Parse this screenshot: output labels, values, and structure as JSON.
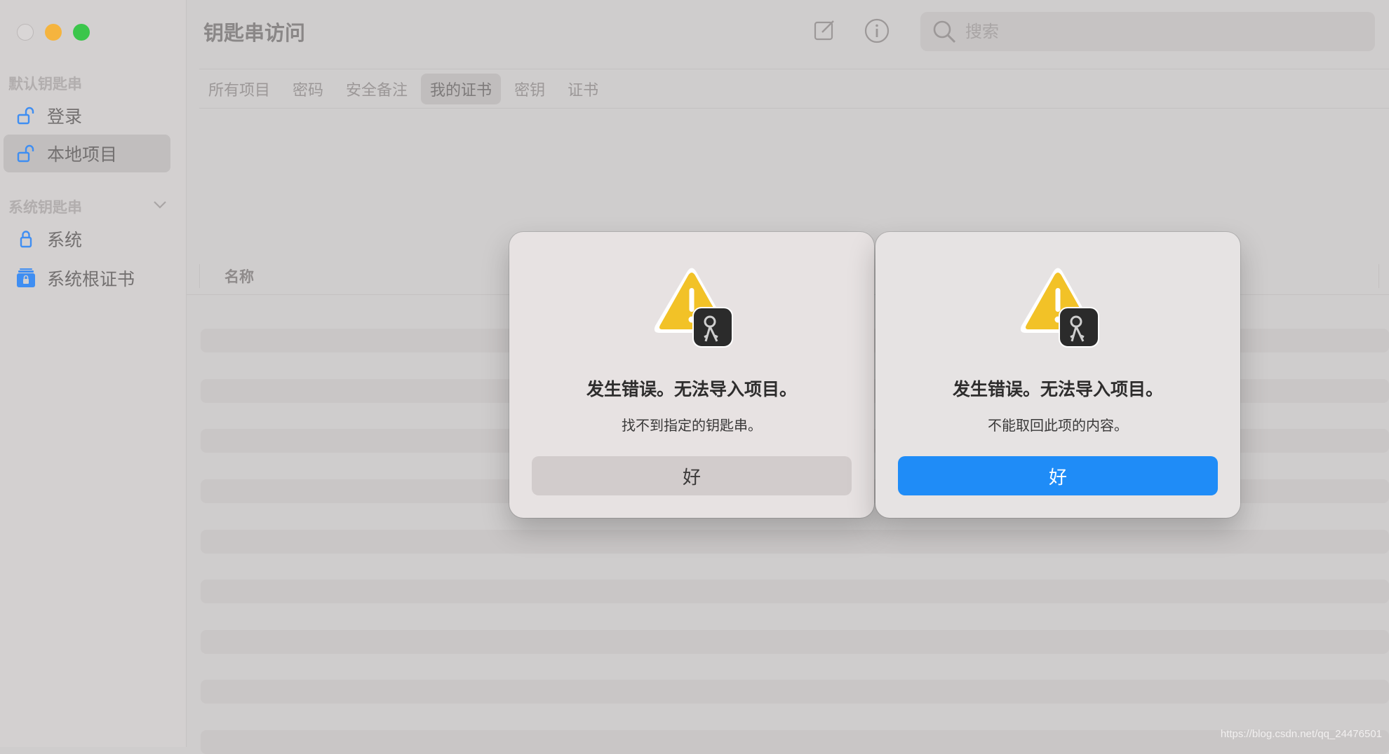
{
  "window": {
    "title": "钥匙串访问"
  },
  "toolbar": {
    "compose_icon": "compose-icon",
    "info_icon": "info-icon",
    "search_placeholder": "搜索"
  },
  "sidebar": {
    "section_default": "默认钥匙串",
    "default_items": [
      {
        "label": "登录",
        "icon": "unlocked-padlock-icon",
        "selected": false
      },
      {
        "label": "本地项目",
        "icon": "unlocked-padlock-icon",
        "selected": true
      }
    ],
    "section_system": "系统钥匙串",
    "system_items": [
      {
        "label": "系统",
        "icon": "locked-padlock-icon"
      },
      {
        "label": "系统根证书",
        "icon": "certificate-cabinet-icon"
      }
    ]
  },
  "tabs": [
    {
      "label": "所有项目",
      "active": false
    },
    {
      "label": "密码",
      "active": false
    },
    {
      "label": "安全备注",
      "active": false
    },
    {
      "label": "我的证书",
      "active": true
    },
    {
      "label": "密钥",
      "active": false
    },
    {
      "label": "证书",
      "active": false
    }
  ],
  "table": {
    "column_name": "名称"
  },
  "dialogs": [
    {
      "title": "发生错误。无法导入项目。",
      "message": "找不到指定的钥匙串。",
      "button": "好",
      "default": false
    },
    {
      "title": "发生错误。无法导入项目。",
      "message": "不能取回此项的内容。",
      "button": "好",
      "default": true
    }
  ],
  "watermark": "https://blog.csdn.net/qq_24476501",
  "colors": {
    "accent": "#1f8cf7",
    "warning": "#f2c227",
    "close": "#d9d6d6",
    "minimize": "#f5b43e",
    "maximize": "#3bc64b"
  }
}
